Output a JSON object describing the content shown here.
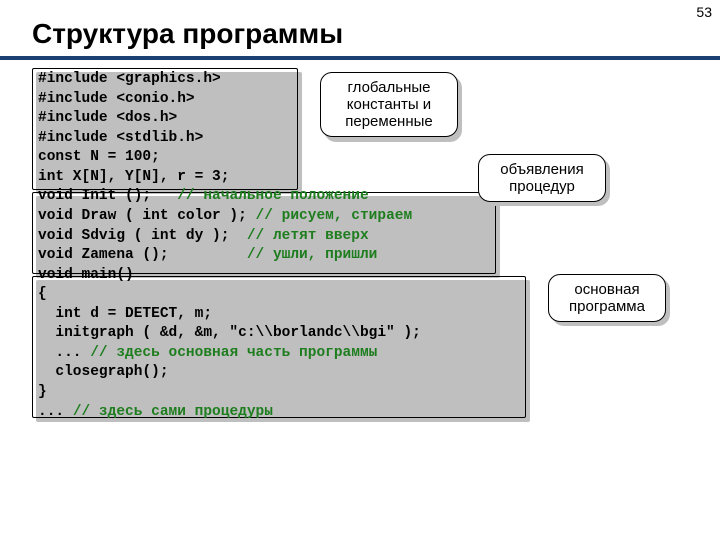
{
  "page_number": "53",
  "title": "Структура программы",
  "code": {
    "l1": "#include <graphics.h>",
    "l2": "#include <conio.h>",
    "l3": "#include <dos.h>",
    "l4": "#include <stdlib.h>",
    "l5": "const N = 100;",
    "l6": "int X[N], Y[N], r = 3;",
    "l7a": "void Init ();   ",
    "l7b": "// начальное положение",
    "l8a": "void Draw ( int color ); ",
    "l8b": "// рисуем, стираем",
    "l9a": "void Sdvig ( int dy );  ",
    "l9b": "// летят вверх",
    "l10a": "void Zamena ();         ",
    "l10b": "// ушли, пришли",
    "l11": "void main()",
    "l12": "{",
    "l13": "  int d = DETECT, m;",
    "l14": "  initgraph ( &d, &m, \"c:\\\\borlandc\\\\bgi\" );",
    "l15a": "  ... ",
    "l15b": "// здесь основная часть программы",
    "l16": "  closegraph();",
    "l17": "}",
    "l18a": "... ",
    "l18b": "// здесь сами процедуры"
  },
  "callouts": {
    "c1": "глобальные константы и переменные",
    "c2": "объявления процедур",
    "c3": "основная программа"
  }
}
